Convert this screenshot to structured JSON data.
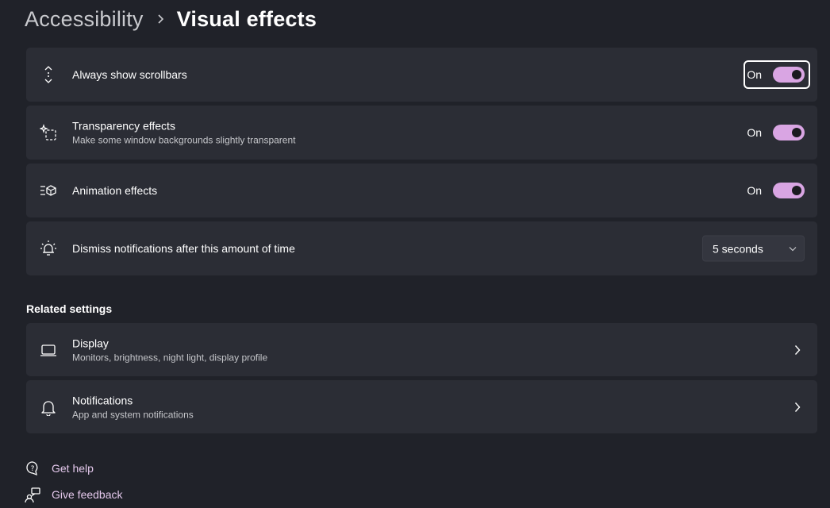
{
  "breadcrumb": {
    "parent": "Accessibility",
    "current": "Visual effects"
  },
  "settings": [
    {
      "title": "Always show scrollbars",
      "description": "",
      "state": "On",
      "icon": "scrollbar-icon"
    },
    {
      "title": "Transparency effects",
      "description": "Make some window backgrounds slightly transparent",
      "state": "On",
      "icon": "transparency-icon"
    },
    {
      "title": "Animation effects",
      "description": "",
      "state": "On",
      "icon": "animation-icon"
    },
    {
      "title": "Dismiss notifications after this amount of time",
      "description": "",
      "value": "5 seconds",
      "icon": "notification-timer-icon"
    }
  ],
  "related": {
    "heading": "Related settings",
    "items": [
      {
        "title": "Display",
        "description": "Monitors, brightness, night light, display profile",
        "icon": "laptop-icon"
      },
      {
        "title": "Notifications",
        "description": "App and system notifications",
        "icon": "bell-icon"
      }
    ]
  },
  "footer": {
    "get_help": "Get help",
    "give_feedback": "Give feedback"
  },
  "colors": {
    "background": "#202229",
    "card": "#2b2d35",
    "accent": "#d9a5e3",
    "link": "#e4c8ec"
  }
}
